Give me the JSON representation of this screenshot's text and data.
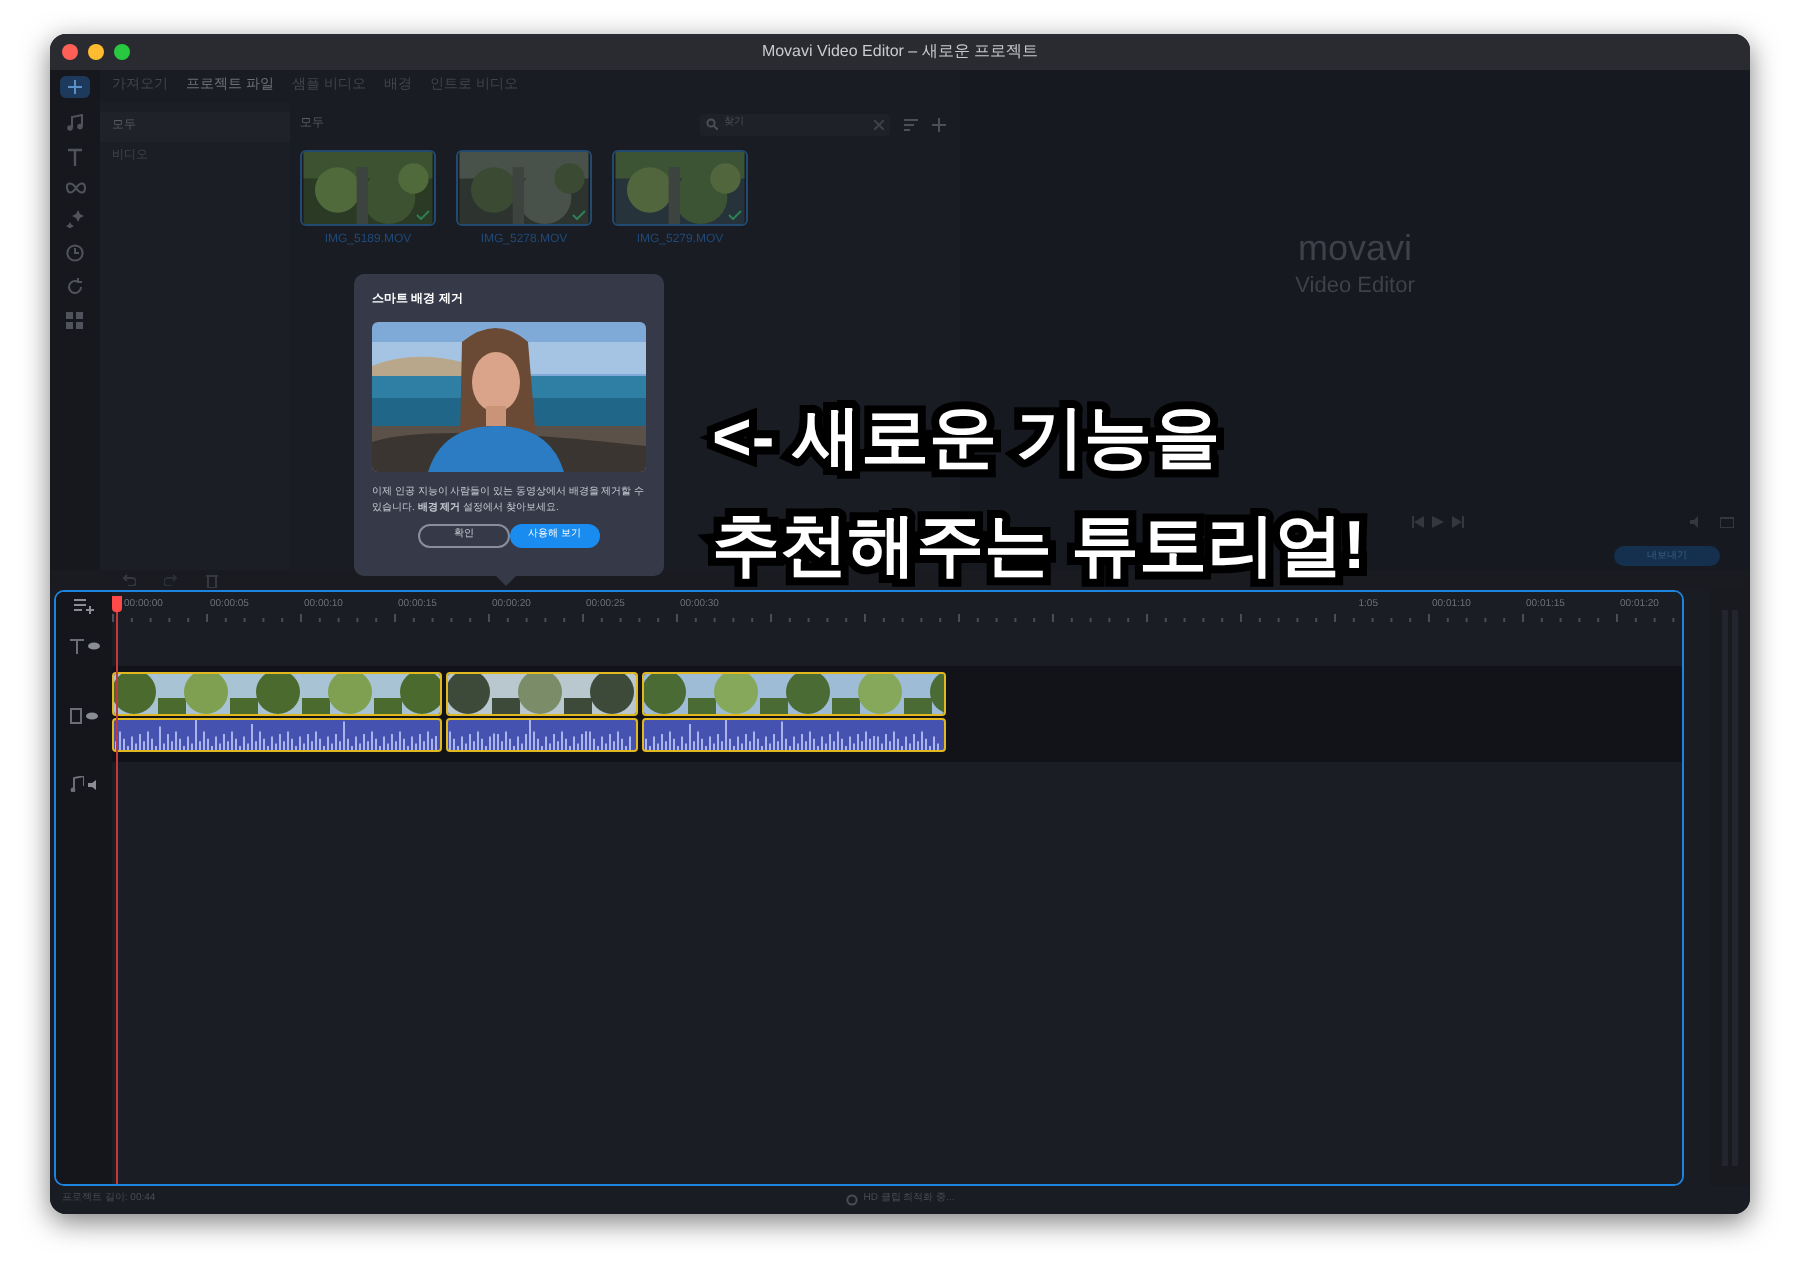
{
  "window": {
    "title": "Movavi Video Editor – 새로운 프로젝트"
  },
  "tabs": [
    {
      "label": "가져오기",
      "selected": false
    },
    {
      "label": "프로젝트 파일",
      "selected": true
    },
    {
      "label": "샘플 비디오",
      "selected": false
    },
    {
      "label": "배경",
      "selected": false
    },
    {
      "label": "인트로 비디오",
      "selected": false
    }
  ],
  "library": {
    "categories": [
      {
        "label": "모두",
        "selected": true
      },
      {
        "label": "비디오",
        "selected": false
      }
    ],
    "heading": "모두",
    "search": {
      "placeholder": "찾기"
    },
    "media": [
      {
        "name": "IMG_5189.MOV",
        "checked": true
      },
      {
        "name": "IMG_5278.MOV",
        "checked": true
      },
      {
        "name": "IMG_5279.MOV",
        "checked": true
      }
    ]
  },
  "player": {
    "logo": "movavi",
    "logo_subtitle": "Video Editor",
    "export": "내보내기"
  },
  "popup": {
    "title": "스마트 배경 제거",
    "body": "이제 인공 지능이 사람들이 있는 동영상에서 배경을 제거할 수 있습니다. **배경 제거** 설정에서 찾아보세요.",
    "buttons": [
      {
        "label": "확인",
        "kind": "secondary"
      },
      {
        "label": "사용해 보기",
        "kind": "primary"
      }
    ]
  },
  "timeline": {
    "ruler": [
      "00:00:00",
      "00:00:05",
      "00:00:10",
      "00:00:15",
      "00:00:20",
      "00:00:25",
      "00:00:30",
      "1:05",
      "00:01:10",
      "00:01:15",
      "00:01:20"
    ],
    "clips": [
      {
        "selected": true
      },
      {
        "selected": true
      },
      {
        "selected": true
      }
    ]
  },
  "status_bar": {
    "duration": "프로젝트 길이: 00:44",
    "message": "HD 클립 최적화 중..."
  },
  "annotation": {
    "lines": [
      "<- 새로운 기능을",
      "추천해주는 튜토리얼!"
    ]
  }
}
